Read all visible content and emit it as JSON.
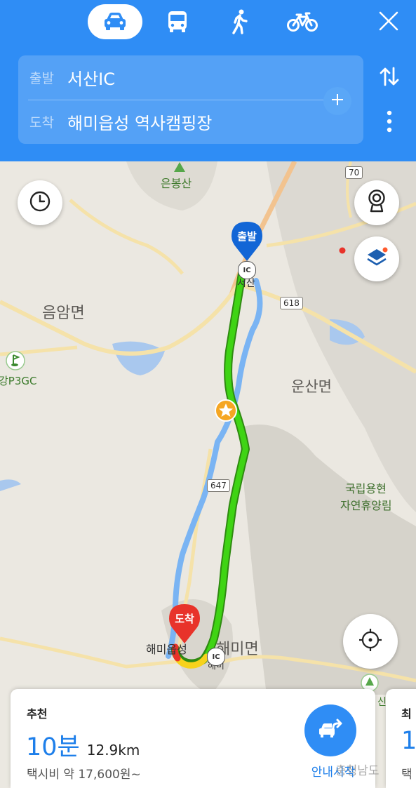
{
  "header": {
    "modes": [
      {
        "name": "car-icon",
        "active": true
      },
      {
        "name": "bus-icon",
        "active": false
      },
      {
        "name": "walk-icon",
        "active": false
      },
      {
        "name": "bike-icon",
        "active": false
      }
    ],
    "origin_label": "출발",
    "origin_value": "서산IC",
    "destination_label": "도착",
    "destination_value": "해미읍성 역사캠핑장"
  },
  "map": {
    "labels": {
      "eunbongsan": "은봉산",
      "eumam": "음암면",
      "golf": "강P3GC",
      "unsan": "운산면",
      "forest_line1": "국립용현",
      "forest_line2": "자연휴양림",
      "haemi_town": "해미면",
      "haemi_fortress": "해미읍성",
      "seosan": "서산",
      "haemi_ic": "해미",
      "partial_right": "신"
    },
    "shields": {
      "r70": "70",
      "r618": "618",
      "r647": "647"
    },
    "ic_badge": "IC",
    "origin_pin": "출발",
    "destination_pin": "도착"
  },
  "result": {
    "tag": "추천",
    "time": "10분",
    "distance": "12.9km",
    "fare": "택시비 약 17,600원~",
    "nav_label": "안내시작",
    "next_tag": "최",
    "next_time": "1",
    "next_fare": "택"
  },
  "watermark": "충청남도",
  "colors": {
    "accent": "#2f8df5",
    "route_green": "#3fd414",
    "route_yellow": "#f7d21c",
    "route_red": "#e8332a"
  }
}
